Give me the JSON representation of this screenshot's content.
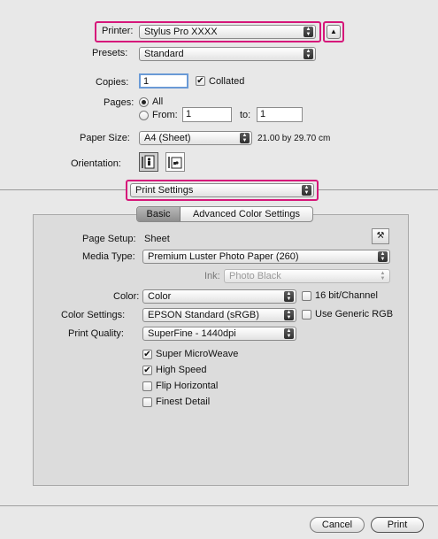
{
  "printer": {
    "label": "Printer:",
    "value": "Stylus Pro XXXX"
  },
  "presets": {
    "label": "Presets:",
    "value": "Standard"
  },
  "copies": {
    "label": "Copies:",
    "value": "1",
    "collated_label": "Collated",
    "collated_checked": true
  },
  "pages": {
    "label": "Pages:",
    "all_label": "All",
    "from_label": "From:",
    "from_value": "1",
    "to_label": "to:",
    "to_value": "1",
    "selected": "All"
  },
  "paper_size": {
    "label": "Paper Size:",
    "value": "A4 (Sheet)",
    "dimensions": "21.00 by 29.70 cm"
  },
  "orientation": {
    "label": "Orientation:"
  },
  "section_popup": {
    "value": "Print Settings"
  },
  "tabs": [
    {
      "label": "Basic",
      "selected": true
    },
    {
      "label": "Advanced Color Settings",
      "selected": false
    }
  ],
  "settings": {
    "page_setup_label": "Page Setup:",
    "page_setup_value": "Sheet",
    "media_type_label": "Media Type:",
    "media_type_value": "Premium Luster Photo Paper (260)",
    "ink_label": "Ink:",
    "ink_value": "Photo Black",
    "color_label": "Color:",
    "color_value": "Color",
    "bit16_label": "16 bit/Channel",
    "color_settings_label": "Color Settings:",
    "color_settings_value": "EPSON Standard (sRGB)",
    "generic_rgb_label": "Use Generic RGB",
    "print_quality_label": "Print Quality:",
    "print_quality_value": "SuperFine - 1440dpi",
    "options": [
      {
        "label": "Super MicroWeave",
        "checked": true
      },
      {
        "label": "High Speed",
        "checked": true
      },
      {
        "label": "Flip Horizontal",
        "checked": false
      },
      {
        "label": "Finest Detail",
        "checked": false
      }
    ]
  },
  "buttons": {
    "cancel": "Cancel",
    "print": "Print"
  },
  "colors": {
    "highlight": "#d6177a",
    "panel": "#dcdcdc"
  }
}
